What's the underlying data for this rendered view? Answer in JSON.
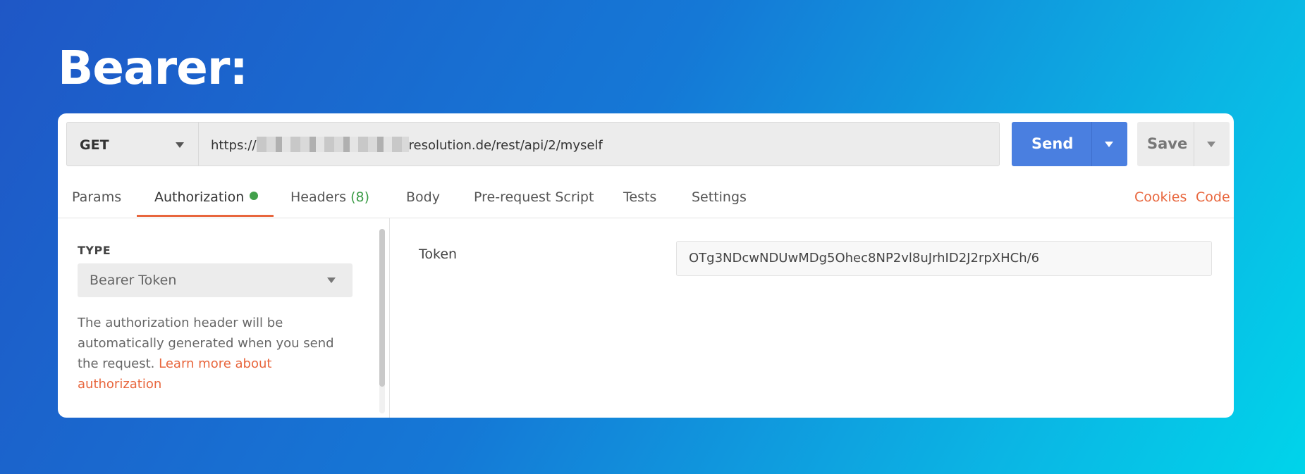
{
  "heading": "Bearer:",
  "request": {
    "method": "GET",
    "url_prefix": "https://",
    "url_suffix": "resolution.de/rest/api/2/myself",
    "send_label": "Send",
    "save_label": "Save"
  },
  "tabs": [
    {
      "label": "Params"
    },
    {
      "label": "Authorization",
      "active": true,
      "indicator": "green-dot"
    },
    {
      "label": "Headers",
      "count": "(8)"
    },
    {
      "label": "Body"
    },
    {
      "label": "Pre-request Script"
    },
    {
      "label": "Tests"
    },
    {
      "label": "Settings"
    }
  ],
  "right_links": {
    "cookies": "Cookies",
    "code": "Code"
  },
  "auth": {
    "type_label": "TYPE",
    "type_value": "Bearer Token",
    "description": "The authorization header will be automatically generated when you send the request.",
    "learn_more": "Learn more about authorization",
    "token_label": "Token",
    "token_value": "OTg3NDcwNDUwMDg5Ohec8NP2vl8uJrhID2J2rpXHCh/6"
  },
  "colors": {
    "accent": "#e8663d",
    "send_button": "#4a7fe0",
    "status_dot": "#42a04b"
  }
}
